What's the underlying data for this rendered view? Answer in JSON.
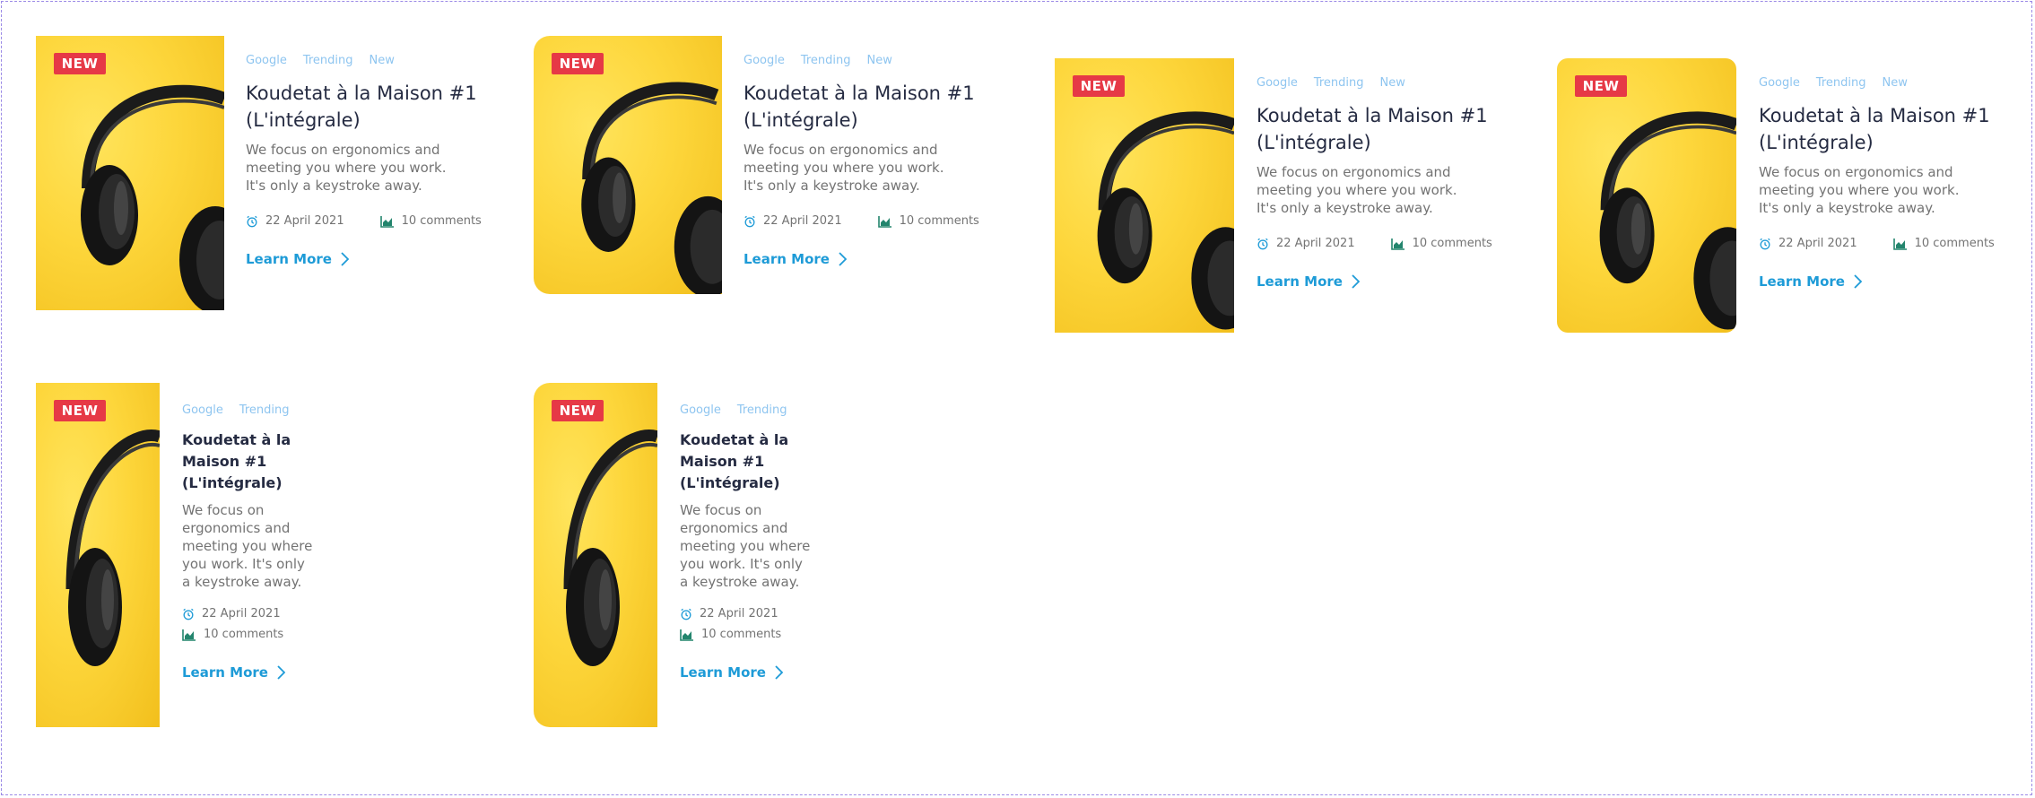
{
  "colors": {
    "badge": "#e63946",
    "tag": "#8ec5f0",
    "title": "#252b42",
    "text": "#737373",
    "link": "#1e9bd7",
    "date_icon": "#1e9bd7",
    "stats_icon": "#23856d",
    "image_bg": "#fdd63b"
  },
  "cards": [
    {
      "badge": "NEW",
      "tags": [
        "Google",
        "Trending",
        "New"
      ],
      "title": "Koudetat à la Maison #1 (L'intégrale)",
      "description": "We focus on ergonomics and meeting you where you work. It's only a keystroke away.",
      "date": "22 April 2021",
      "comments": "10 comments",
      "cta": "Learn More"
    },
    {
      "badge": "NEW",
      "tags": [
        "Google",
        "Trending",
        "New"
      ],
      "title": "Koudetat à la Maison #1 (L'intégrale)",
      "description": "We focus on ergonomics and meeting you where you work. It's only a keystroke away.",
      "date": "22 April 2021",
      "comments": "10 comments",
      "cta": "Learn More"
    },
    {
      "badge": "NEW",
      "tags": [
        "Google",
        "Trending",
        "New"
      ],
      "title": "Koudetat à la Maison #1 (L'intégrale)",
      "description": "We focus on ergonomics and meeting you where you work. It's only a keystroke away.",
      "date": "22 April 2021",
      "comments": "10 comments",
      "cta": "Learn More"
    },
    {
      "badge": "NEW",
      "tags": [
        "Google",
        "Trending",
        "New"
      ],
      "title": "Koudetat à la Maison #1 (L'intégrale)",
      "description": "We focus on ergonomics and meeting you where you work. It's only a keystroke away.",
      "date": "22 April 2021",
      "comments": "10 comments",
      "cta": "Learn More"
    },
    {
      "badge": "NEW",
      "tags": [
        "Google",
        "Trending"
      ],
      "title": "Koudetat à la Maison #1 (L'intégrale)",
      "description": "We focus on ergonomics and meeting you where you work. It's only a keystroke away.",
      "date": "22 April 2021",
      "comments": "10 comments",
      "cta": "Learn More"
    },
    {
      "badge": "NEW",
      "tags": [
        "Google",
        "Trending"
      ],
      "title": "Koudetat à la Maison #1 (L'intégrale)",
      "description": "We focus on ergonomics and meeting you where you work. It's only a keystroke away.",
      "date": "22 April 2021",
      "comments": "10 comments",
      "cta": "Learn More"
    }
  ],
  "icons": {
    "badge": "new-badge",
    "date": "alarm-clock-icon",
    "comments": "area-chart-icon",
    "cta": "chevron-right-icon",
    "image": "headphones-image"
  }
}
